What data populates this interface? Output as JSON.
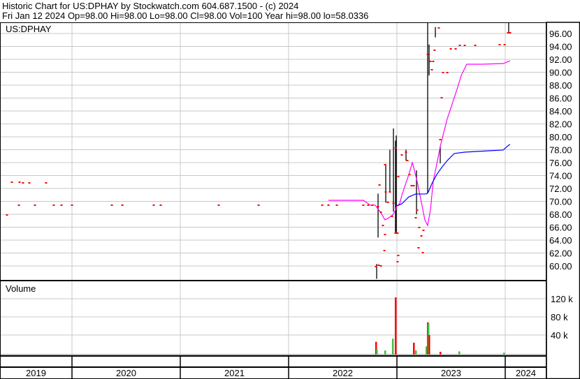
{
  "header": {
    "line1": "Historic Chart for US:DPHAY by Stockwatch.com 604.687.1500 - (c) 2024",
    "line2": "Fri Jan 12 2024  Op=98.00  Hi=98.00  Lo=98.00  Cl=98.00  Vol=100  Year hi=98.00  lo=58.0336"
  },
  "colors": {
    "close": "#ff0000",
    "range": "#000000",
    "ma_short": "#ff00ff",
    "ma_long": "#0000ff",
    "vol_up": "#44bb44",
    "vol_down": "#ff0000",
    "grid": "#c8c8c8"
  },
  "chart_data": [
    {
      "type": "line",
      "title": "US:DPHAY",
      "x_unit": "decimal year",
      "xlim": [
        2019.34,
        2024.39
      ],
      "ylim": [
        58,
        97.7
      ],
      "yticks": [
        60,
        62,
        64,
        66,
        68,
        70,
        72,
        74,
        76,
        78,
        80,
        82,
        84,
        86,
        88,
        90,
        92,
        94,
        96
      ],
      "ytick_labels": [
        "60.00",
        "62.00",
        "64.00",
        "66.00",
        "68.00",
        "70.00",
        "72.00",
        "74.00",
        "76.00",
        "78.00",
        "80.00",
        "82.00",
        "84.00",
        "86.00",
        "88.00",
        "90.00",
        "92.00",
        "94.00",
        "96.00"
      ],
      "closes": [
        [
          2019.4,
          67.89
        ],
        [
          2019.445,
          72.97
        ],
        [
          2019.516,
          72.97
        ],
        [
          2019.548,
          72.86
        ],
        [
          2019.606,
          72.86
        ],
        [
          2019.761,
          72.86
        ],
        [
          2019.51,
          69.41
        ],
        [
          2019.658,
          69.41
        ],
        [
          2019.832,
          69.41
        ],
        [
          2019.903,
          69.41
        ],
        [
          2020.0,
          69.41
        ],
        [
          2020.368,
          69.41
        ],
        [
          2020.465,
          69.41
        ],
        [
          2020.755,
          69.41
        ],
        [
          2020.819,
          69.41
        ],
        [
          2021.355,
          69.41
        ],
        [
          2021.723,
          69.41
        ],
        [
          2022.31,
          69.41
        ],
        [
          2022.368,
          69.41
        ],
        [
          2022.445,
          69.41
        ],
        [
          2022.69,
          69.41
        ],
        [
          2022.735,
          69.41
        ],
        [
          2022.774,
          69.41
        ],
        [
          2022.826,
          69.19
        ],
        [
          2022.852,
          68.32
        ],
        [
          2022.871,
          66.27
        ],
        [
          2022.89,
          64.86
        ],
        [
          2022.839,
          72.54
        ],
        [
          2022.89,
          75.68
        ],
        [
          2022.897,
          71.46
        ],
        [
          2022.935,
          71.46
        ],
        [
          2022.916,
          69.84
        ],
        [
          2022.955,
          67.68
        ],
        [
          2022.968,
          69.73
        ],
        [
          2022.987,
          78.27
        ],
        [
          2022.987,
          65.08
        ],
        [
          2023.006,
          65.08
        ],
        [
          2023.013,
          73.84
        ],
        [
          2023.045,
          77.19
        ],
        [
          2023.084,
          77.62
        ],
        [
          2023.097,
          76.32
        ],
        [
          2023.116,
          74.16
        ],
        [
          2023.135,
          72.43
        ],
        [
          2023.155,
          72.43
        ],
        [
          2023.187,
          68.65
        ],
        [
          2023.174,
          67.46
        ],
        [
          2023.226,
          64.65
        ],
        [
          2023.206,
          65.95
        ],
        [
          2023.245,
          65.51
        ],
        [
          2023.2,
          62.81
        ],
        [
          2023.239,
          62.05
        ],
        [
          2022.884,
          62.38
        ],
        [
          2022.852,
          60.0
        ],
        [
          2022.806,
          59.89
        ],
        [
          2022.832,
          60.11
        ],
        [
          2023.013,
          61.62
        ],
        [
          2023.006,
          60.65
        ],
        [
          2023.4,
          79.57
        ],
        [
          2023.31,
          91.68
        ],
        [
          2023.335,
          91.68
        ],
        [
          2023.284,
          92.76
        ],
        [
          2023.348,
          93.41
        ],
        [
          2023.387,
          96.86
        ],
        [
          2023.426,
          89.95
        ],
        [
          2023.465,
          89.95
        ],
        [
          2023.413,
          86.05
        ],
        [
          2023.497,
          93.62
        ],
        [
          2023.542,
          93.62
        ],
        [
          2023.581,
          94.16
        ],
        [
          2023.626,
          94.16
        ],
        [
          2023.723,
          94.16
        ],
        [
          2023.948,
          94.27
        ],
        [
          2023.994,
          94.27
        ],
        [
          2024.026,
          96.11
        ],
        [
          2024.045,
          96.11
        ],
        [
          2023.323,
          90.38
        ]
      ],
      "ranges": [
        [
          2022.826,
          71.2,
          64.4
        ],
        [
          2022.813,
          60.3,
          58.0
        ],
        [
          2022.897,
          75.8,
          69.8
        ],
        [
          2022.935,
          78.0,
          71.5
        ],
        [
          2022.968,
          81.3,
          68.4
        ],
        [
          2022.987,
          79.4,
          65.2
        ],
        [
          2022.994,
          80.2,
          65.2
        ],
        [
          2023.084,
          78.0,
          76.3
        ],
        [
          2023.181,
          74.8,
          68.0
        ],
        [
          2023.284,
          97.7,
          71.2
        ],
        [
          2023.4,
          78.5,
          75.9
        ],
        [
          2023.297,
          94.3,
          89.5
        ],
        [
          2023.355,
          97.0,
          95.4
        ],
        [
          2024.032,
          97.7,
          96.0
        ]
      ],
      "series": [
        {
          "name": "ma_short",
          "points": [
            [
              2022.368,
              70.16
            ],
            [
              2022.69,
              70.16
            ],
            [
              2022.755,
              69.41
            ],
            [
              2022.8,
              69.41
            ],
            [
              2022.852,
              68.22
            ],
            [
              2022.89,
              67.14
            ],
            [
              2022.916,
              67.35
            ],
            [
              2022.961,
              67.89
            ],
            [
              2022.981,
              68.43
            ],
            [
              2023.0,
              69.3
            ],
            [
              2023.026,
              69.62
            ],
            [
              2023.045,
              70.92
            ],
            [
              2023.077,
              72.54
            ],
            [
              2023.11,
              74.16
            ],
            [
              2023.142,
              76.0
            ],
            [
              2023.155,
              75.24
            ],
            [
              2023.187,
              73.08
            ],
            [
              2023.226,
              69.84
            ],
            [
              2023.258,
              67.14
            ],
            [
              2023.284,
              66.27
            ],
            [
              2023.31,
              68.76
            ],
            [
              2023.335,
              73.08
            ],
            [
              2023.368,
              75.78
            ],
            [
              2023.4,
              78.49
            ],
            [
              2023.432,
              80.65
            ],
            [
              2023.465,
              82.81
            ],
            [
              2023.497,
              84.43
            ],
            [
              2023.529,
              86.05
            ],
            [
              2023.561,
              87.68
            ],
            [
              2023.594,
              89.51
            ],
            [
              2023.645,
              91.24
            ],
            [
              2023.787,
              91.24
            ],
            [
              2023.981,
              91.35
            ],
            [
              2024.045,
              91.78
            ]
          ]
        },
        {
          "name": "ma_long",
          "points": [
            [
              2023.0,
              69.3
            ],
            [
              2023.045,
              69.62
            ],
            [
              2023.11,
              70.7
            ],
            [
              2023.174,
              71.14
            ],
            [
              2023.271,
              71.14
            ],
            [
              2023.29,
              71.46
            ],
            [
              2023.323,
              72.76
            ],
            [
              2023.368,
              74.16
            ],
            [
              2023.413,
              75.24
            ],
            [
              2023.465,
              76.32
            ],
            [
              2023.529,
              77.41
            ],
            [
              2023.626,
              77.62
            ],
            [
              2023.852,
              77.84
            ],
            [
              2023.981,
              77.95
            ],
            [
              2024.032,
              78.7
            ],
            [
              2024.045,
              78.8
            ]
          ]
        }
      ]
    },
    {
      "type": "bar",
      "title": "Volume",
      "ylim": [
        0,
        140
      ],
      "y_unit": "k",
      "yticks": [
        40,
        80,
        120
      ],
      "ytick_labels": [
        "40 k",
        "80 k",
        "120 k"
      ],
      "bars": [
        [
          2022.806,
          25,
          "down"
        ],
        [
          2022.813,
          9,
          "up"
        ],
        [
          2022.89,
          6,
          "up"
        ],
        [
          2022.961,
          32,
          "up"
        ],
        [
          2022.987,
          123,
          "down"
        ],
        [
          2023.155,
          23,
          "down"
        ],
        [
          2023.174,
          6,
          "up"
        ],
        [
          2023.271,
          15,
          "up"
        ],
        [
          2023.284,
          68,
          "down"
        ],
        [
          2023.29,
          66,
          "up"
        ],
        [
          2023.297,
          40,
          "down"
        ],
        [
          2023.4,
          3,
          "down"
        ],
        [
          2023.574,
          4,
          "up"
        ],
        [
          2023.987,
          1,
          "up"
        ]
      ],
      "xtick_labels": [
        "2019",
        "2020",
        "2021",
        "2022",
        "2023",
        "2024"
      ]
    }
  ]
}
